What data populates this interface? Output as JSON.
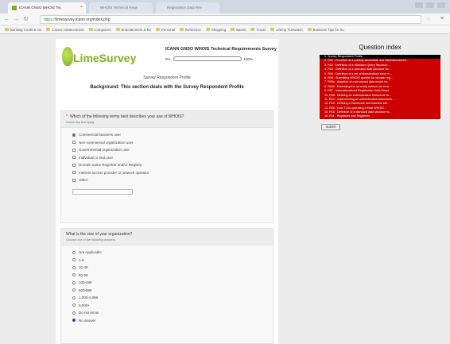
{
  "browser": {
    "active_tab_title": "ICANN GNSO WHOIS Tec",
    "inactive_tabs": [
      "WHOIS Technical Reqs",
      "Registration Data Rev"
    ],
    "url_prefix": "https://",
    "url_rest": "limesurvey.icann.org/index.php",
    "bookmarks": [
      "Banking Credit & Ins",
      "Career Advancement",
      "Computers",
      "Entertainment & Re",
      "Personal",
      "Reference",
      "Shopping",
      "Sports",
      "Travel",
      "uTemp TLDwatch",
      "Business Tips for Su"
    ]
  },
  "survey": {
    "logo_text": "LimeSurvey",
    "title": "ICANN GNSO WHOIS Technical Requirements Survey",
    "progress_start": "0%",
    "progress_end": "100%",
    "progress_value": 0,
    "section_name": "Survey Respondent Profile",
    "section_desc": "Background: This section deals with the Survey Respondent Profile"
  },
  "q1": {
    "text": "Which of the following terms best describes your use of WHOIS?",
    "help": "Check any that apply",
    "options": [
      {
        "label": "Commercial business user",
        "checked": true
      },
      {
        "label": "Non-commercial organization user",
        "checked": false
      },
      {
        "label": "Governmental organization user",
        "checked": false
      },
      {
        "label": "Individual or end user",
        "checked": false
      },
      {
        "label": "Domain name Registrar and/or Registry",
        "checked": false
      },
      {
        "label": "Internet access provider or network operator",
        "checked": false
      },
      {
        "label": "Other:",
        "checked": false
      }
    ]
  },
  "q2": {
    "text": "What is the size of your organization?",
    "help": "Choose one of the following answers",
    "options": [
      {
        "label": "Not Applicable",
        "checked": false
      },
      {
        "label": "1-9",
        "checked": false
      },
      {
        "label": "10-49",
        "checked": false
      },
      {
        "label": "50-99",
        "checked": false
      },
      {
        "label": "100-499",
        "checked": false
      },
      {
        "label": "500-999",
        "checked": false
      },
      {
        "label": "1,000-4,999",
        "checked": false
      },
      {
        "label": "5,000+",
        "checked": false
      },
      {
        "label": "Do not know",
        "checked": false
      },
      {
        "label": "No answer",
        "checked": true
      }
    ]
  },
  "index": {
    "title": "Question index",
    "items": [
      "1. Survey Respondent Profile",
      "2. R01 : Provision of a publicly accessible and internationalized...",
      "3. R02 : Definition of a Standard Query Structure...",
      "4. R03 : Definition of a standard data structure for...",
      "5. R04 : Definition of a set of standardized error m...",
      "6. R05 : Submitting WHOIS queries for domain reg...",
      "7. R05a : Adoption of a structured data model for...",
      "8. R05b : Extending the currently defined set of re...",
      "9. R07 : Internationalized Registration Data Requi...",
      "10. R08 : Defining an authentication framework fo...",
      "11. R09 : Implementing an authentication framework...",
      "12. R10 : Defining a framework and baseline set...",
      "13. R08 : How TLDs operating a thick WHOIS...",
      "14. R10 : Definition of a standard data structure fo...",
      "15. R11 : Registrars and Registries"
    ],
    "submit_label": "Submit"
  }
}
